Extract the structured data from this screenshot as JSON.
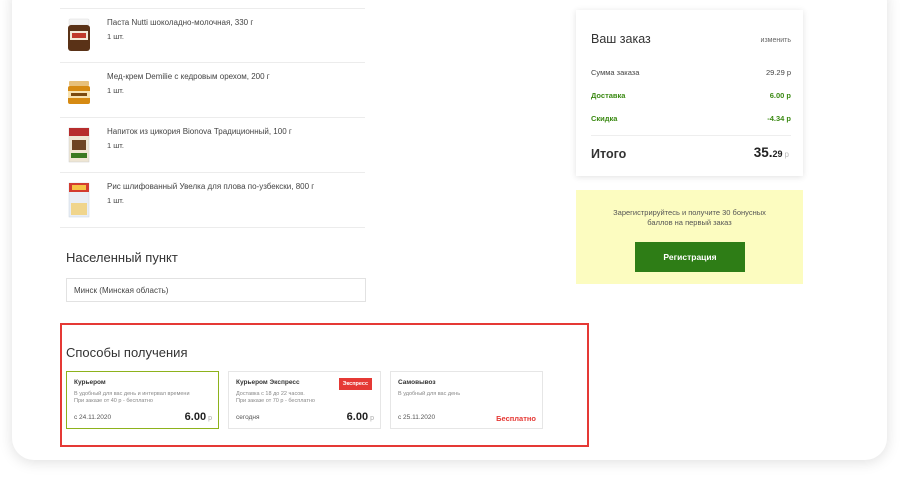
{
  "products": [
    {
      "name": "Паста Nutti шоколадно-молочная, 330 г",
      "qty": "1 шт.",
      "icon": "nutella-jar-icon"
    },
    {
      "name": "Мед-крем Demilie с кедровым орехом, 200 г",
      "qty": "1 шт.",
      "icon": "honey-jar-icon"
    },
    {
      "name": "Напиток из цикория Bionova Традиционный, 100 г",
      "qty": "1 шт.",
      "icon": "chicory-pack-icon"
    },
    {
      "name": "Рис шлифованный Увелка для плова по-узбекски, 800 г",
      "qty": "1 шт.",
      "icon": "rice-pack-icon"
    }
  ],
  "city": {
    "title": "Населенный пункт",
    "value": "Минск (Минская область)"
  },
  "delivery": {
    "title": "Способы получения",
    "options": [
      {
        "title": "Курьером",
        "desc1": "В удобный для вас день и интервал времени",
        "desc2": "При заказе от 40 р - бесплатно",
        "date": "с 24.11.2020",
        "price": "6.00",
        "currency": "р",
        "selected": true
      },
      {
        "title": "Курьером Экспресс",
        "badge": "Экспресс",
        "desc1": "Доставка с 18 до 22 часов.",
        "desc2": "При заказе от 70 р - бесплатно",
        "date": "сегодня",
        "price": "6.00",
        "currency": "р"
      },
      {
        "title": "Самовывоз",
        "desc1": "В удобный для вас день",
        "desc2": "",
        "date": "с 25.11.2020",
        "free": "Бесплатно"
      }
    ]
  },
  "summary": {
    "title": "Ваш заказ",
    "edit": "изменить",
    "rows": [
      {
        "label": "Сумма заказа",
        "value": "29.29 р"
      },
      {
        "label": "Доставка",
        "value": "6.00 р"
      },
      {
        "label": "Скидка",
        "value": "-4.34 р"
      }
    ],
    "total_label": "Итого",
    "total_int": "35.",
    "total_dec": "29",
    "total_cur": "р"
  },
  "promo": {
    "text": "Зарегистрируйтесь и получите 30 бонусных баллов на первый заказ",
    "button": "Регистрация"
  },
  "colors": {
    "accent_green": "#2e7d16",
    "selected_border": "#8db21c",
    "red": "#e53935",
    "promo_bg": "#fcfcc0"
  }
}
